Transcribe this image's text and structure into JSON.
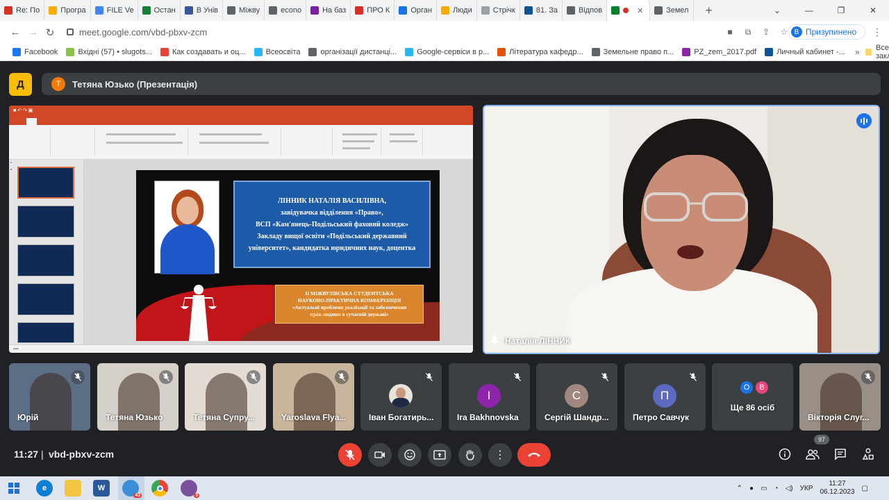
{
  "browser": {
    "tabs": [
      {
        "label": "Re: По",
        "color": "#d93025"
      },
      {
        "label": "Програ",
        "color": "#f9ab00"
      },
      {
        "label": "FILE Ve",
        "color": "#4285f4"
      },
      {
        "label": "Остан",
        "color": "#188038"
      },
      {
        "label": "В Унів",
        "color": "#3b5998"
      },
      {
        "label": "Міжву",
        "color": "#5f6368"
      },
      {
        "label": "econo",
        "color": "#5f6368"
      },
      {
        "label": "На баз",
        "color": "#7b1fa2"
      },
      {
        "label": "ПРО К",
        "color": "#d93025"
      },
      {
        "label": "Орган",
        "color": "#1a73e8"
      },
      {
        "label": "Люди",
        "color": "#f9ab00"
      },
      {
        "label": "Стрічк",
        "color": "#9aa0a6"
      },
      {
        "label": "81. За",
        "color": "#0b5394"
      },
      {
        "label": "Відпов",
        "color": "#5f6368"
      },
      {
        "label": "",
        "color": "#00832d",
        "active": true
      },
      {
        "label": "Земел",
        "color": "#5f6368"
      }
    ],
    "new_tab_symbol": "+",
    "url": "meet.google.com/vbd-pbxv-zcm",
    "profile_initial": "B",
    "profile_label": "Призупинено"
  },
  "bookmarks": {
    "items": [
      {
        "label": "Facebook",
        "color": "#1877f2"
      },
      {
        "label": "Вхідні (57) • slugots...",
        "color": "#8bc34a"
      },
      {
        "label": "Как создавать и оц...",
        "color": "#ea4335"
      },
      {
        "label": "Всеосвіта",
        "color": "#29b6f6"
      },
      {
        "label": "організації дистанці...",
        "color": "#5f6368"
      },
      {
        "label": "Google-сервіси в р...",
        "color": "#29b6f6"
      },
      {
        "label": "Література кафедр...",
        "color": "#e65100"
      },
      {
        "label": "Земельне право п...",
        "color": "#5f6368"
      },
      {
        "label": "PZ_zem_2017.pdf",
        "color": "#8e24aa"
      },
      {
        "label": "Личный кабинет -...",
        "color": "#0b5394"
      }
    ],
    "overflow": "»",
    "all_label": "Все закладки"
  },
  "meet": {
    "presenter_initial": "Т",
    "presenter_label": "Тетяна Юзько (Презентація)",
    "speaker_name": "Наталія ЛІННИК",
    "participants": [
      {
        "name": "Юрій",
        "bg": "#5b6e86"
      },
      {
        "name": "Тетяна Юзько",
        "bg": "#d6d0cb"
      },
      {
        "name": "Тетяна Супру...",
        "bg": "#e2dcd5"
      },
      {
        "name": "Yaroslava Flya...",
        "bg": "#c9b59c"
      },
      {
        "name": "Іван Богатирь...",
        "bg": "#3c4043",
        "avatar": "photo"
      },
      {
        "name": "Ira Bakhnovska",
        "bg": "#3c4043",
        "initial": "I",
        "avatar_color": "#8e24aa"
      },
      {
        "name": "Сергій Шандр...",
        "bg": "#3c4043",
        "initial": "С",
        "avatar_color": "#a1887f"
      },
      {
        "name": "Петро Савчук",
        "bg": "#3c4043",
        "initial": "П",
        "avatar_color": "#5c6bc0"
      },
      {
        "name": "Ще 86 осіб",
        "bg": "#3c4043",
        "more": true
      },
      {
        "name": "Вікторія Слуг...",
        "bg": "#9a8f86"
      }
    ],
    "more_initials": [
      {
        "initial": "О",
        "color": "#1a73e8"
      },
      {
        "initial": "В",
        "color": "#e8457a"
      }
    ],
    "time": "11:27",
    "separator": "|",
    "code": "vbd-pbxv-zcm",
    "people_count": "97"
  },
  "slide": {
    "bio_lines": [
      "ЛІННИК НАТАЛІЯ ВАСИЛІВНА,",
      "завідувачка відділення «Право»,",
      "ВСП «Кам'янець-Подільський фаховий коледж»",
      "Закладу вищої освіти «Подільський державний",
      "університет», кандидатка юридичних наук, доцентка"
    ],
    "conf_lines": [
      "ІІ МІЖВУЗІВСЬКА СТУДЕНТСЬКА",
      "НАУКОВО-ПРАКТИЧНА КОНФЕРЕНЦІЯ",
      "«Актуальні проблеми реалізації та забезпечення",
      "прав людини в сучасній державі»"
    ]
  },
  "taskbar": {
    "lang": "УКР",
    "time": "11:27",
    "date": "06.12.2023",
    "badge_mail": "43",
    "badge_viber": "3"
  }
}
